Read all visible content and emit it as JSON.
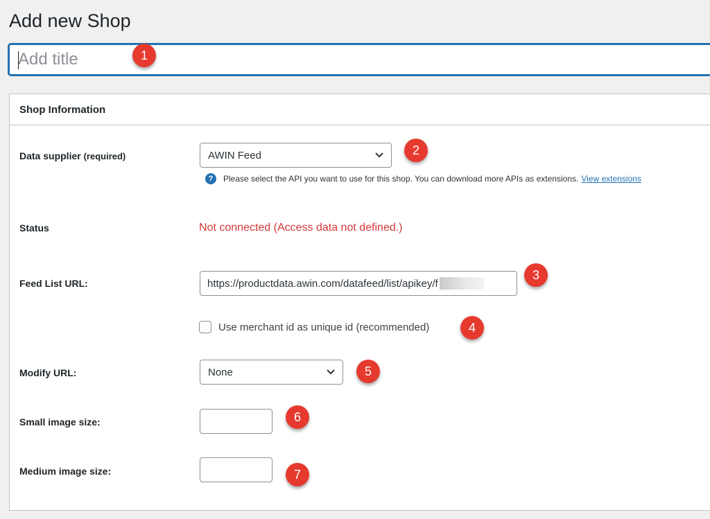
{
  "header": {
    "title": "Add new Shop"
  },
  "title_field": {
    "placeholder": "Add title"
  },
  "panel": {
    "title": "Shop Information"
  },
  "fields": {
    "data_supplier": {
      "label": "Data supplier",
      "required_label": "(required)",
      "value": "AWIN Feed",
      "help_text": "Please select the API you want to use for this shop. You can download more APIs as extensions.",
      "help_link": "View extensions",
      "help_icon": "question-circle-icon"
    },
    "status": {
      "label": "Status",
      "value": "Not connected (Access data not defined.)",
      "color": "#d63638"
    },
    "feed_list_url": {
      "label": "Feed List URL:",
      "value": "https://productdata.awin.com/datafeed/list/apikey/f"
    },
    "merchant_id": {
      "label": "Use merchant id as unique id (recommended)",
      "checked": false
    },
    "modify_url": {
      "label": "Modify URL:",
      "value": "None"
    },
    "small_image_size": {
      "label": "Small image size:",
      "value": ""
    },
    "medium_image_size": {
      "label": "Medium image size:",
      "value": ""
    }
  },
  "annotations": [
    "1",
    "2",
    "3",
    "4",
    "5",
    "6",
    "7"
  ],
  "colors": {
    "accent": "#2271b1",
    "badge": "#e63a2e",
    "error": "#d63638"
  }
}
